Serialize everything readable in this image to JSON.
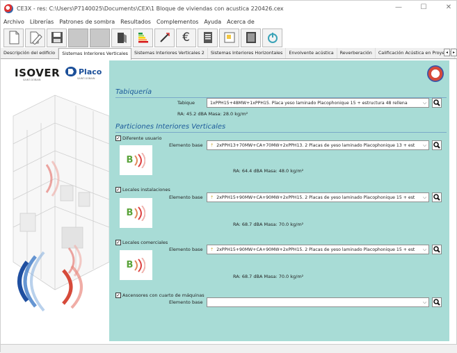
{
  "window": {
    "title": "CE3X - res: C:\\Users\\P7140025\\Documents\\CEX\\1 Bloque de viviendas con acustica 220426.cex",
    "minimize": "—",
    "maximize": "☐",
    "close": "✕"
  },
  "menu": [
    "Archivo",
    "Librerías",
    "Patrones de sombra",
    "Resultados",
    "Complementos",
    "Ayuda",
    "Acerca de"
  ],
  "toolbar": {
    "buttons": [
      "new-file-icon",
      "open-file-icon",
      "save-icon",
      "disabled",
      "disabled",
      "book-icon",
      "energy-label-icon",
      "measure-icon",
      "euro-icon",
      "document-icon",
      "image-icon",
      "report-icon",
      "power-icon"
    ]
  },
  "tabs": {
    "items": [
      "Descripción del edificio",
      "Sistemas Interiores Verticales",
      "Sistemas Interiores Verticales 2",
      "Sistemas Interiores Horizontales",
      "Envolvente acústica",
      "Reverberación",
      "Calificación Acústica en Proyecto"
    ],
    "active": "Sistemas Interiores Verticales",
    "scroll_left": "◂",
    "scroll_right": "▸"
  },
  "brand": {
    "isover": "ISOVER",
    "isover_sub": "SAINT-GOBAIN",
    "placo": "Placo",
    "placo_sub": "SAINT-GOBAIN"
  },
  "tabiqueria": {
    "title": "Tabiquería",
    "tabique_label": "Tabique",
    "tabique_value": "1xPPH15+48MW+1xPPH15. Placa yeso laminado Placophonique 15 + estructura 48 rellena",
    "result": "RA: 45.2 dBA   Masa: 28.0 kg/m²"
  },
  "particiones": {
    "title": "Particiones Interiores Verticales",
    "items": [
      {
        "check_label": "Diferente usuario",
        "checked": "✓",
        "element_label": "Elemento base",
        "value": "2xPPH13+70MW+CA+70MW+2xPPH13. 2 Placas de yeso laminado Placophonique 13 + est",
        "result": "RA: 64.4 dBA   Masa: 48.0 kg/m²",
        "badge": "B"
      },
      {
        "check_label": "Locales instalaciones",
        "checked": "✓",
        "element_label": "Elemento base",
        "value": "2xPPH15+90MW+CA+90MW+2xPPH15. 2 Placas de yeso laminado Placophonique 15 + est",
        "result": "RA: 68.7 dBA   Masa: 70.0 kg/m²",
        "badge": "B"
      },
      {
        "check_label": "Locales comerciales",
        "checked": "✓",
        "element_label": "Elemento base",
        "value": "2xPPH15+90MW+CA+90MW+2xPPH15. 2 Placas de yeso laminado Placophonique 15 + est",
        "result": "RA: 68.7 dBA   Masa: 70.0 kg/m²",
        "badge": "B"
      }
    ],
    "ascensores": {
      "check_label": "Ascensores con cuarto de máquinas",
      "checked": "✓",
      "element_label": "Elemento base",
      "value": ""
    }
  },
  "colors": {
    "main_bg": "#a8dcd6",
    "title_blue": "#1b5a9a",
    "badge_green": "#5aa33a"
  }
}
